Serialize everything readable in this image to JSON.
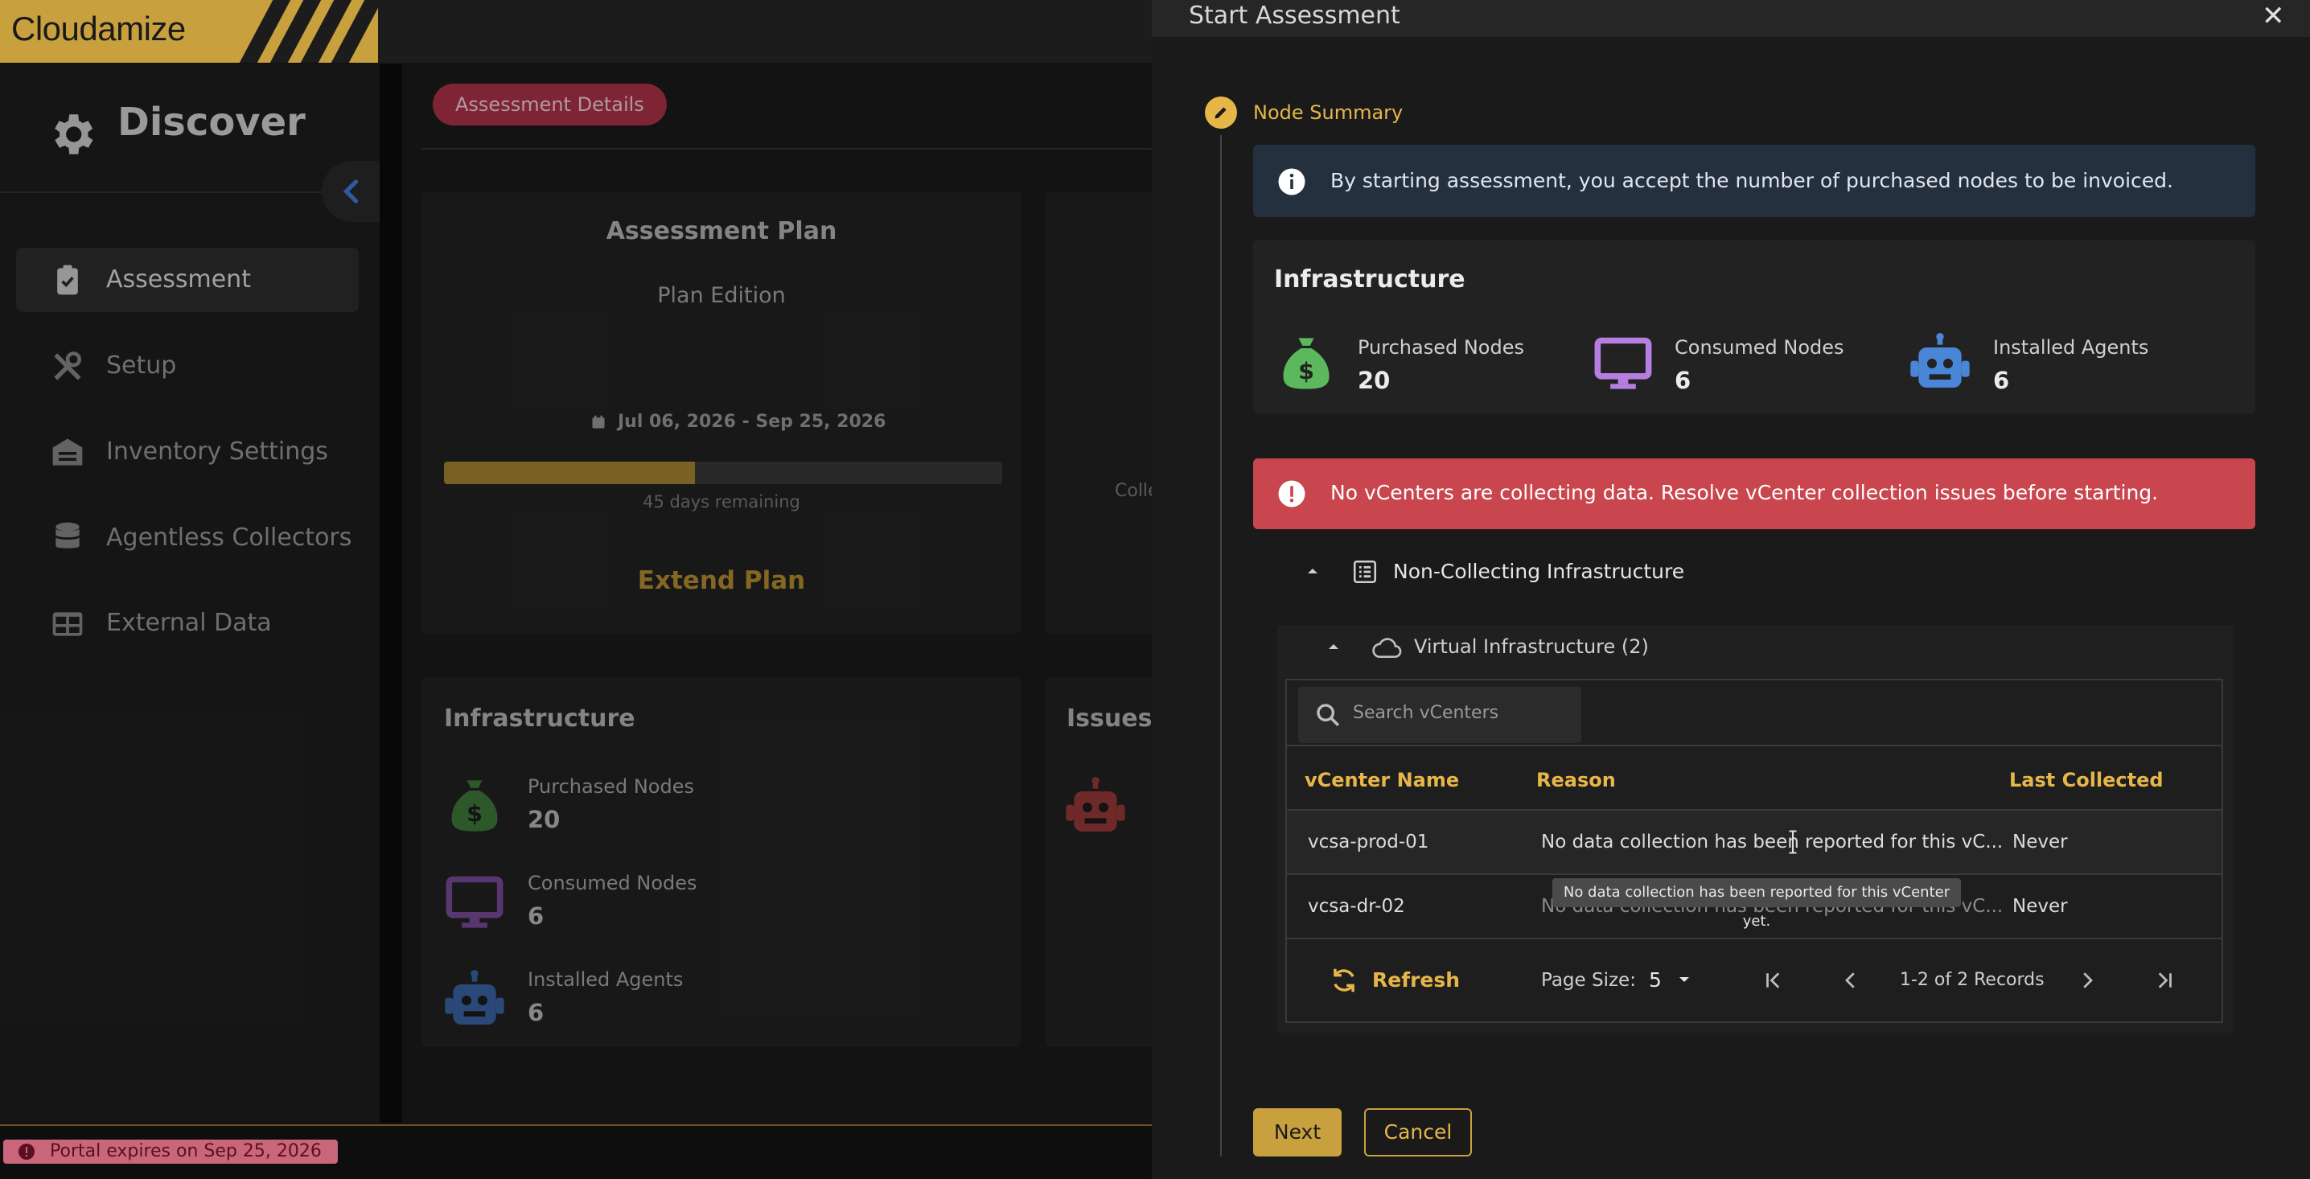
{
  "app": {
    "brand": "Cloudamize",
    "section_title": "Discover"
  },
  "sidebar": {
    "items": [
      {
        "label": "Assessment",
        "icon": "clipboard-check-icon",
        "active": true
      },
      {
        "label": "Setup",
        "icon": "tools-icon",
        "active": false
      },
      {
        "label": "Inventory Settings",
        "icon": "warehouse-icon",
        "active": false
      },
      {
        "label": "Agentless Collectors",
        "icon": "database-icon",
        "active": false
      },
      {
        "label": "External Data",
        "icon": "table-icon",
        "active": false
      }
    ]
  },
  "main": {
    "tab_pill": "Assessment Details",
    "plan_card": {
      "title": "Assessment Plan",
      "edition": "Plan Edition",
      "date_range": "Jul 06, 2026 - Sep 25, 2026",
      "progress_fraction": 0.45,
      "remaining": "45 days remaining",
      "extend_label": "Extend Plan"
    },
    "partial_text": "Colle",
    "infra_card": {
      "title": "Infrastructure",
      "purchased_label": "Purchased Nodes",
      "purchased_value": "20",
      "consumed_label": "Consumed Nodes",
      "consumed_value": "6",
      "agents_label": "Installed Agents",
      "agents_value": "6"
    },
    "issues_title": "Issues"
  },
  "status_bar": {
    "expires_text": "Portal expires on Sep 25, 2026"
  },
  "modal": {
    "title": "Start Assessment",
    "step_label": "Node Summary",
    "info_text": "By starting assessment, you accept the number of purchased nodes to be invoiced.",
    "infrastructure": {
      "title": "Infrastructure",
      "purchased_label": "Purchased Nodes",
      "purchased_value": "20",
      "consumed_label": "Consumed Nodes",
      "consumed_value": "6",
      "agents_label": "Installed Agents",
      "agents_value": "6"
    },
    "error_text": "No vCenters are collecting data. Resolve vCenter collection issues before starting.",
    "non_collecting_label": "Non-Collecting Infrastructure",
    "virtual_label": "Virtual Infrastructure (2)",
    "search_placeholder": "Search vCenters",
    "columns": [
      "vCenter Name",
      "Reason",
      "Last Collected"
    ],
    "rows": [
      {
        "name": "vcsa-prod-01",
        "reason": "No data collection has been reported for this vC...",
        "last": "Never"
      },
      {
        "name": "vcsa-dr-02",
        "reason": "No data collection has been reported for this vC...",
        "last": "Never"
      }
    ],
    "tooltip": "No data collection has been reported for this vCenter yet.",
    "refresh_label": "Refresh",
    "page_size_label": "Page Size:",
    "page_size_value": "5",
    "records_text": "1-2 of 2 Records",
    "next_label": "Next",
    "cancel_label": "Cancel"
  },
  "colors": {
    "accent": "#c9a03e",
    "error": "#c9464e",
    "pill": "#b0334a"
  }
}
